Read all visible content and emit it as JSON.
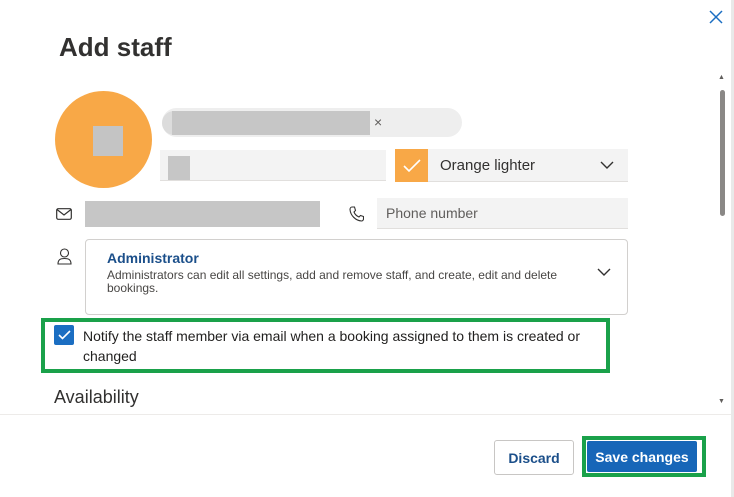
{
  "dialog": {
    "title": "Add staff",
    "close_icon": "close-icon"
  },
  "profile": {
    "name_clear_icon": "×",
    "color": {
      "label": "Orange lighter",
      "swatch_color": "#f8a847"
    },
    "avatar_color": "#f8a847"
  },
  "contact": {
    "email_icon": "mail-icon",
    "phone_icon": "phone-icon",
    "phone_placeholder": "Phone number"
  },
  "role": {
    "person_icon": "person-icon",
    "title": "Administrator",
    "description": "Administrators can edit all settings, add and remove staff, and create, edit and delete bookings."
  },
  "notify": {
    "checked": true,
    "text": "Notify the staff member via email when a booking assigned to them is created or changed"
  },
  "availability": {
    "title": "Availability"
  },
  "footer": {
    "discard_label": "Discard",
    "save_label": "Save changes"
  },
  "colors": {
    "accent": "#1766b8",
    "highlight": "#1aa14a"
  }
}
